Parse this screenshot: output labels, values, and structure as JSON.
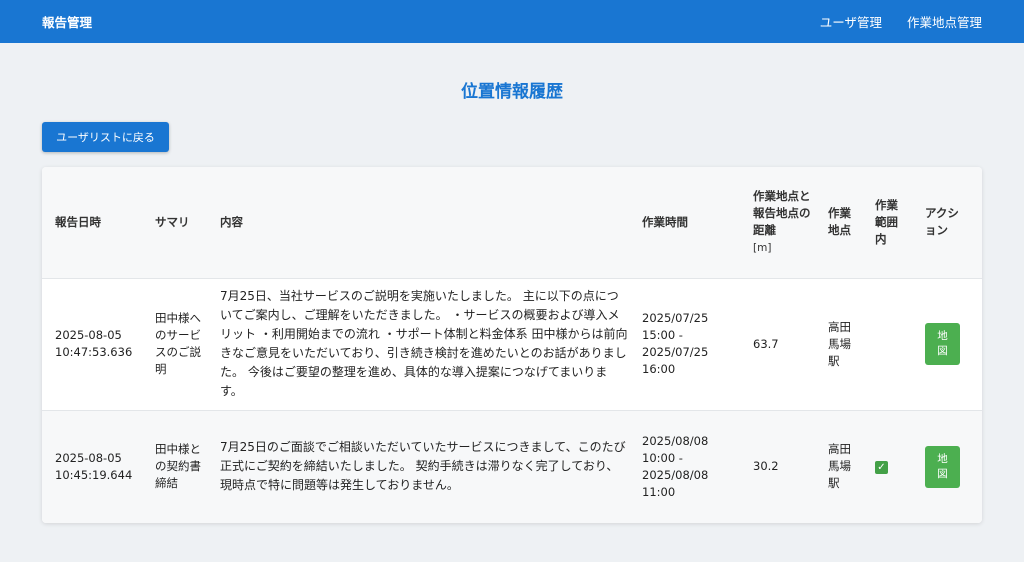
{
  "navbar": {
    "brand": "報告管理",
    "links": [
      "ユーザ管理",
      "作業地点管理"
    ]
  },
  "page": {
    "title": "位置情報履歴",
    "back_button": "ユーザリストに戻る"
  },
  "table": {
    "headers": {
      "date": "報告日時",
      "summary": "サマリ",
      "content": "内容",
      "work_time": "作業時間",
      "distance": "作業地点と報告地点の距離",
      "distance_unit": "[m]",
      "location": "作業地点",
      "in_range": "作業範囲内",
      "action": "アクション"
    },
    "rows": [
      {
        "date": "2025-08-05 10:47:53.636",
        "summary": "田中様へのサービスのご説明",
        "content": "7月25日、当社サービスのご説明を実施いたしました。 主に以下の点についてご案内し、ご理解をいただきました。 ・サービスの概要および導入メリット ・利用開始までの流れ ・サポート体制と料金体系 田中様からは前向きなご意見をいただいており、引き続き検討を進めたいとのお話がありました。 今後はご要望の整理を進め、具体的な導入提案につなげてまいります。",
        "work_time": "2025/07/25 15:00 - 2025/07/25 16:00",
        "distance": "63.7",
        "location": "高田馬場駅",
        "in_range": false,
        "action": "地図"
      },
      {
        "date": "2025-08-05 10:45:19.644",
        "summary": "田中様との契約書締結",
        "content": "7月25日のご面談でご相談いただいていたサービスにつきまして、このたび正式にご契約を締結いたしました。 契約手続きは滞りなく完了しており、現時点で特に問題等は発生しておりません。",
        "work_time": "2025/08/08 10:00 - 2025/08/08 11:00",
        "distance": "30.2",
        "location": "高田馬場駅",
        "in_range": true,
        "action": "地図"
      }
    ]
  },
  "colors": {
    "primary": "#1976d2",
    "action_green": "#4caf50",
    "check_green": "#43a047"
  },
  "icons": {
    "in_range": "check-icon"
  }
}
